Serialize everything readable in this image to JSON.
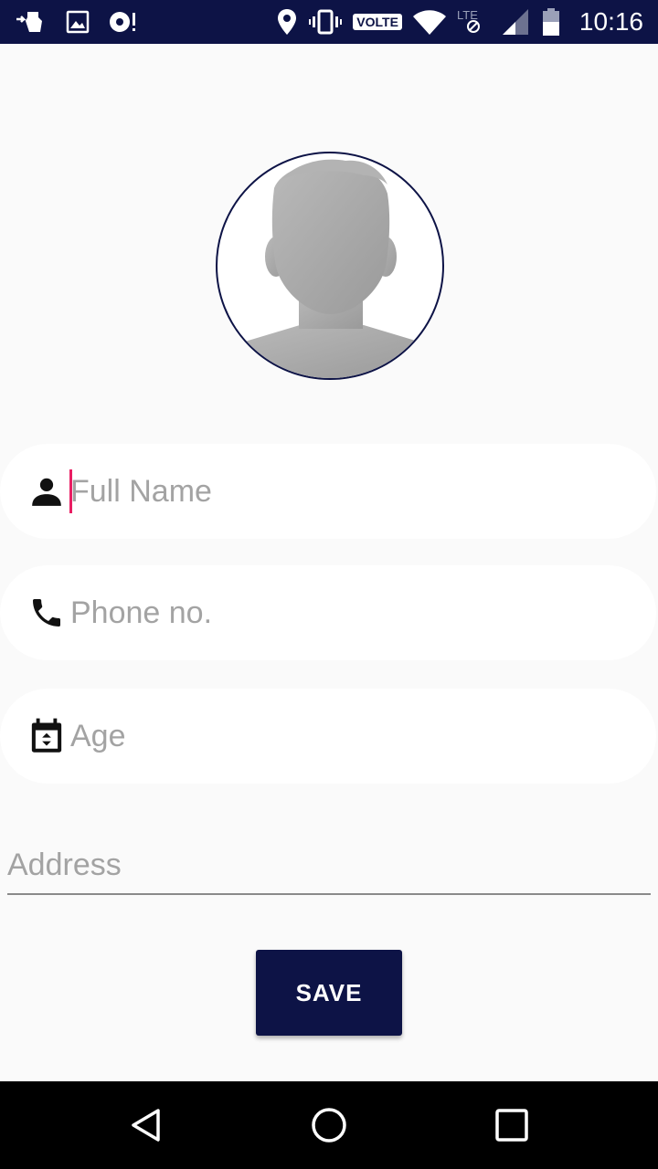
{
  "status_bar": {
    "left_icons": [
      "usb-debug-icon",
      "image-icon",
      "sync-alert-icon"
    ],
    "right_icons": [
      "location-icon",
      "vibrate-icon",
      "wifi-icon",
      "lte-icon",
      "signal-icon",
      "battery-icon"
    ],
    "volte_label": "VOLTE",
    "time": "10:16",
    "background": "#0d1346"
  },
  "profile": {
    "avatar_icon": "default-avatar-icon",
    "border_color": "#0d1346"
  },
  "form": {
    "full_name": {
      "placeholder": "Full Name",
      "value": "",
      "icon": "person-icon",
      "focused": true
    },
    "phone": {
      "placeholder": "Phone no.",
      "value": "",
      "icon": "phone-icon"
    },
    "age": {
      "placeholder": "Age",
      "value": "",
      "icon": "calendar-icon"
    },
    "address": {
      "placeholder": "Address",
      "value": ""
    },
    "save_label": "SAVE"
  },
  "colors": {
    "primary": "#0d1346",
    "cursor": "#e91e63",
    "placeholder": "#a3a3a3",
    "background": "#fafafa"
  },
  "nav_bar": {
    "buttons": [
      "back-icon",
      "home-icon",
      "recents-icon"
    ]
  }
}
